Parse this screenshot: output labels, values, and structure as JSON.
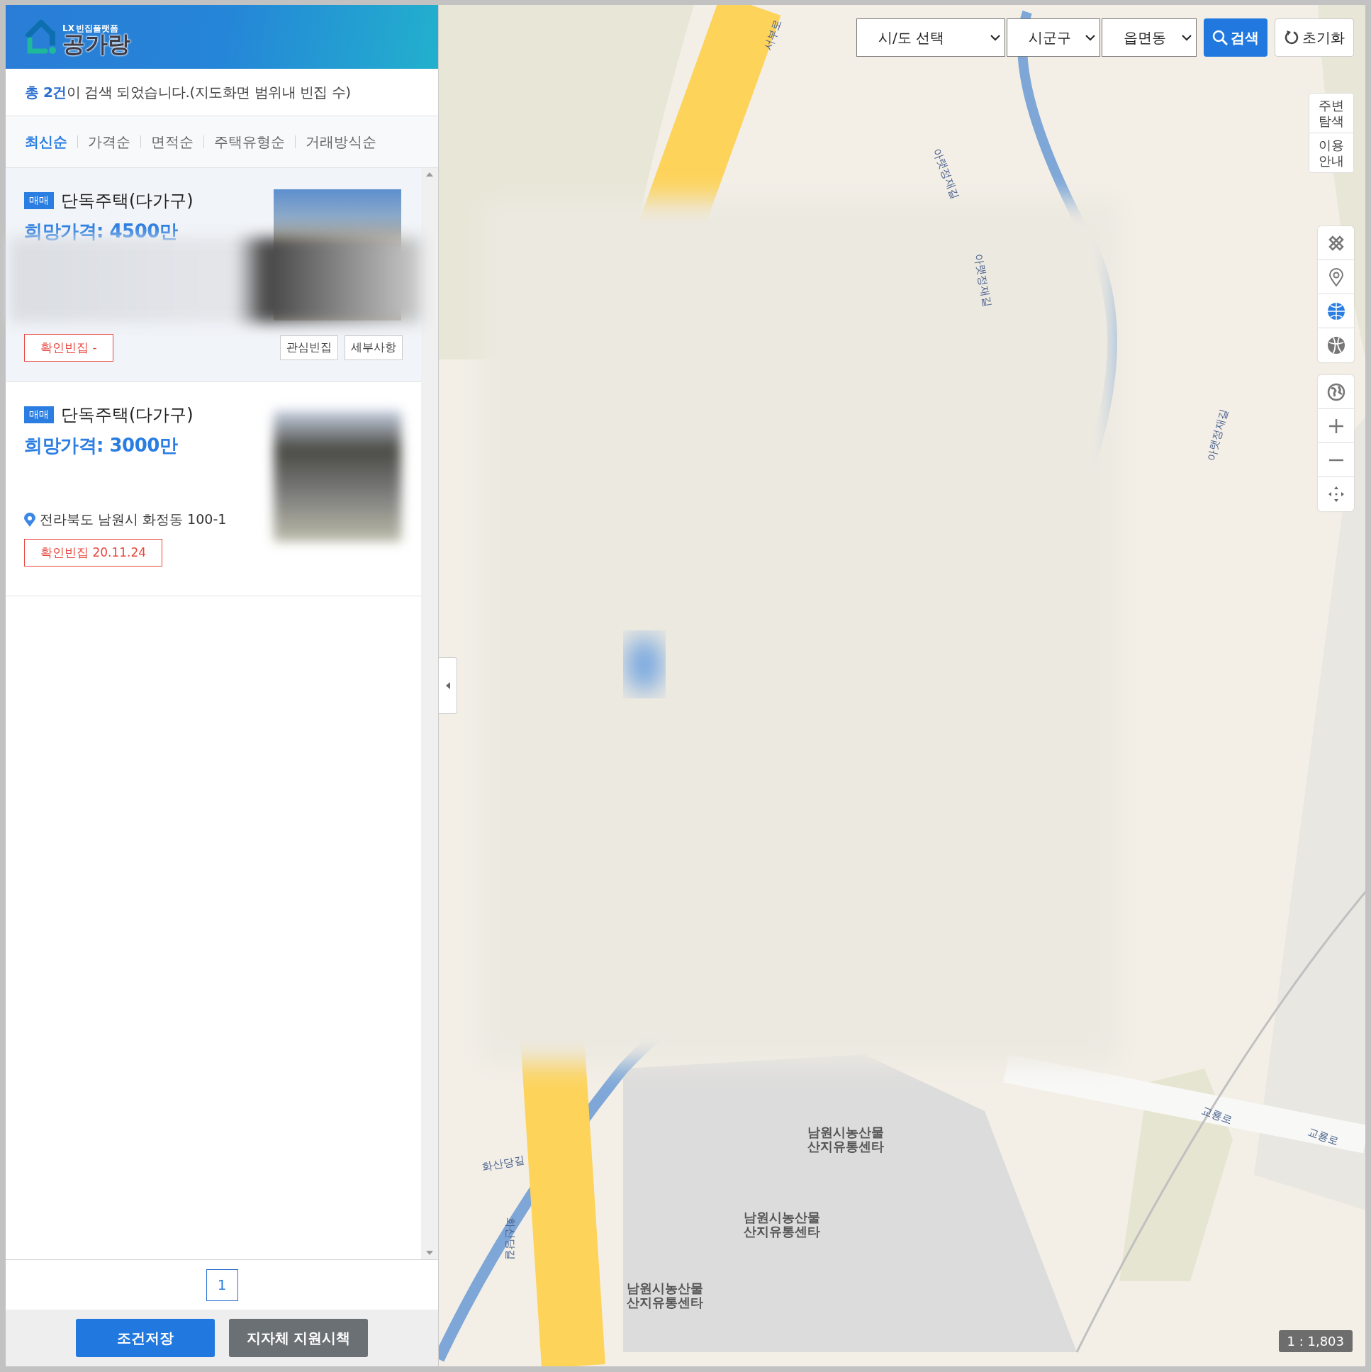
{
  "logo": {
    "mark": "LX",
    "tagline": "빈집플랫폼",
    "name": "공가랑"
  },
  "summary": "**총 2건**이 검색 되었습니다.(지도화면 범위내 빈집 수)",
  "sort_tabs": [
    {
      "label": "최신순",
      "selected": true
    },
    {
      "label": "가격순",
      "selected": false
    },
    {
      "label": "면적순",
      "selected": false
    },
    {
      "label": "주택유형순",
      "selected": false
    },
    {
      "label": "거래방식순",
      "selected": false
    }
  ],
  "listings": [
    {
      "badge": "매매",
      "title": "단독주택(다가구)",
      "price": "희망가격: 4500만",
      "selected": true,
      "redacted": true,
      "confirm": "확인빈집 -",
      "buttons": [
        "관심빈집",
        "세부사항"
      ]
    },
    {
      "badge": "매매",
      "title": "단독주택(다가구)",
      "price": "희망가격: 3000만",
      "selected": false,
      "redacted": false,
      "address": "전라북도 남원시 화정동 100-1",
      "confirm": "확인빈집 20.11.24"
    }
  ],
  "pagination": [
    {
      "label": "1",
      "selected": true
    }
  ],
  "footer_buttons": [
    {
      "label": "조건저장",
      "kind": "primary"
    },
    {
      "label": "지자체 지원시책",
      "kind": "secondary"
    }
  ],
  "map": {
    "selects": [
      "시/도 선택",
      "시군구",
      "읍면동"
    ],
    "search_button": "검색",
    "reset_button": "초기화",
    "side_menu": [
      "주변 탐색",
      "이용 안내"
    ],
    "tools": [
      {
        "kind": "measure",
        "selected": false
      },
      {
        "kind": "pin",
        "selected": false
      },
      {
        "kind": "layer",
        "selected": true
      },
      {
        "kind": "satellite",
        "selected": false
      }
    ],
    "labels": [
      {
        "text": "서부로",
        "kind": "road"
      },
      {
        "text": "아랫정재길",
        "kind": "road"
      },
      {
        "text": "아랫정재길",
        "kind": "road"
      },
      {
        "text": "아랫정재길",
        "kind": "road"
      },
      {
        "text": "화산당길",
        "kind": "road"
      },
      {
        "text": "화산당길",
        "kind": "road"
      },
      {
        "text": "교룡로",
        "kind": "road"
      },
      {
        "text": "교룡로",
        "kind": "road"
      },
      {
        "text": "남원시농산물\n산지유통센타",
        "kind": "place"
      },
      {
        "text": "남원시농산물\n산지유통센타",
        "kind": "place"
      },
      {
        "text": "남원시농산물\n산지유통센타",
        "kind": "place"
      }
    ],
    "scale": "1 : 1,803"
  }
}
